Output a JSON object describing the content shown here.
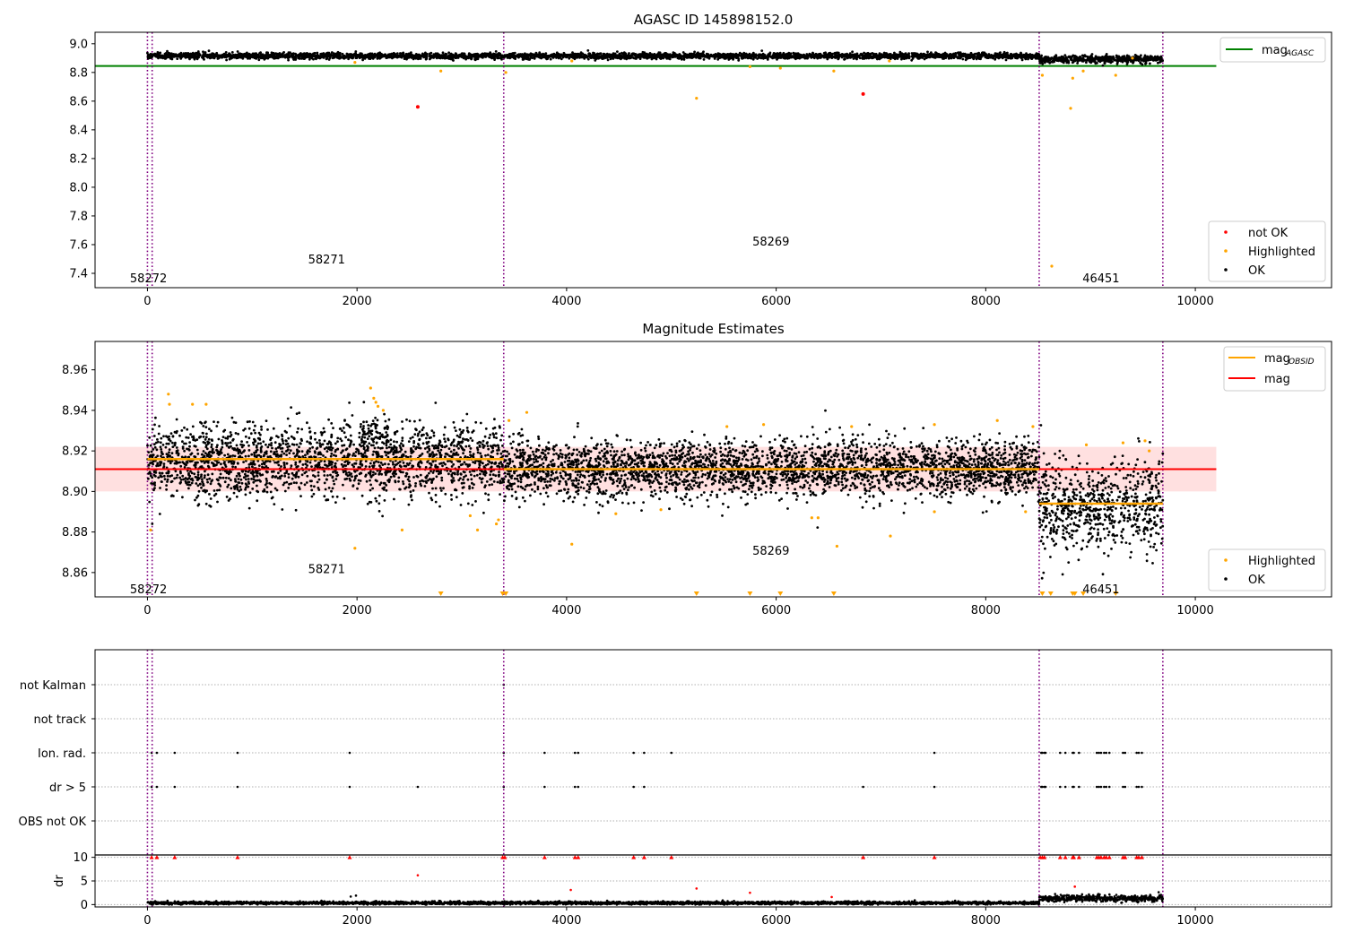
{
  "chart_data": [
    {
      "type": "scatter",
      "title": "AGASC ID 145898152.0",
      "xlim": [
        -500,
        11300
      ],
      "ylim": [
        7.3,
        9.08
      ],
      "xticks": [
        0,
        2000,
        4000,
        6000,
        8000,
        10000
      ],
      "yticks": [
        7.4,
        7.6,
        7.8,
        8.0,
        8.2,
        8.4,
        8.6,
        8.8,
        9.0
      ],
      "mag_agasc": 8.845,
      "obs_boundaries": [
        0,
        45,
        3400,
        8510,
        9690
      ],
      "obs_labels": [
        {
          "text": "58272",
          "x": 10,
          "y": 7.37
        },
        {
          "text": "58271",
          "x": 1710,
          "y": 7.5
        },
        {
          "text": "58269",
          "x": 5950,
          "y": 7.625
        },
        {
          "text": "46451",
          "x": 9100,
          "y": 7.37
        }
      ],
      "ok_segments": [
        {
          "x0": 0,
          "x1": 8510,
          "mean": 8.915,
          "sd": 0.01
        },
        {
          "x0": 8510,
          "x1": 9690,
          "mean": 8.893,
          "sd": 0.013
        }
      ],
      "not_ok": [
        [
          2580,
          8.56
        ],
        [
          6830,
          8.65
        ]
      ],
      "highlighted": [
        [
          2800,
          8.81
        ],
        [
          1980,
          8.87
        ],
        [
          3420,
          8.8
        ],
        [
          5240,
          8.62
        ],
        [
          5750,
          8.84
        ],
        [
          6040,
          8.83
        ],
        [
          6550,
          8.81
        ],
        [
          7080,
          8.88
        ],
        [
          4050,
          8.88
        ],
        [
          8540,
          8.78
        ],
        [
          8810,
          8.55
        ],
        [
          8830,
          8.76
        ],
        [
          8930,
          8.81
        ],
        [
          8630,
          7.45
        ],
        [
          9240,
          8.78
        ],
        [
          9400,
          8.9
        ]
      ],
      "legend_lines": [
        {
          "name": "mag",
          "sub": "AGASC",
          "color": "#008000"
        }
      ],
      "legend_points": [
        {
          "name": "not OK",
          "color": "#ff0000"
        },
        {
          "name": "Highlighted",
          "color": "#ffa500"
        },
        {
          "name": "OK",
          "color": "#000000"
        }
      ]
    },
    {
      "type": "scatter",
      "title": "Magnitude Estimates",
      "xlim": [
        -500,
        11300
      ],
      "ylim": [
        8.848,
        8.974
      ],
      "xticks": [
        0,
        2000,
        4000,
        6000,
        8000,
        10000
      ],
      "yticks": [
        8.86,
        8.88,
        8.9,
        8.92,
        8.94,
        8.96
      ],
      "mag": 8.911,
      "mag_band": [
        8.9,
        8.922
      ],
      "mag_obsid_segments": [
        {
          "x0": 0,
          "x1": 3400,
          "y": 8.916
        },
        {
          "x0": 3400,
          "x1": 8510,
          "y": 8.911
        },
        {
          "x0": 8510,
          "x1": 9690,
          "y": 8.894
        }
      ],
      "obs_boundaries": [
        0,
        45,
        3400,
        8510,
        9690
      ],
      "obs_labels": [
        {
          "text": "58272",
          "x": 10,
          "y": 8.852
        },
        {
          "text": "58271",
          "x": 1710,
          "y": 8.862
        },
        {
          "text": "58269",
          "x": 5950,
          "y": 8.871
        },
        {
          "text": "46451",
          "x": 9100,
          "y": 8.852
        }
      ],
      "ok_segments": [
        {
          "x0": 0,
          "x1": 3400,
          "mean": 8.915,
          "sd": 0.009
        },
        {
          "x0": 3400,
          "x1": 8510,
          "mean": 8.911,
          "sd": 0.007
        },
        {
          "x0": 8510,
          "x1": 9690,
          "mean": 8.893,
          "sd": 0.011
        }
      ],
      "highlighted": [
        [
          200,
          8.948
        ],
        [
          210,
          8.943
        ],
        [
          430,
          8.943
        ],
        [
          560,
          8.943
        ],
        [
          2130,
          8.951
        ],
        [
          2160,
          8.946
        ],
        [
          2180,
          8.944
        ],
        [
          2200,
          8.942
        ],
        [
          2250,
          8.94
        ],
        [
          30,
          8.881
        ],
        [
          1980,
          8.872
        ],
        [
          2430,
          8.881
        ],
        [
          3080,
          8.888
        ],
        [
          3150,
          8.881
        ],
        [
          3330,
          8.884
        ],
        [
          3350,
          8.886
        ],
        [
          3450,
          8.935
        ],
        [
          3620,
          8.939
        ],
        [
          4050,
          8.874
        ],
        [
          4470,
          8.889
        ],
        [
          4900,
          8.891
        ],
        [
          5530,
          8.932
        ],
        [
          5880,
          8.933
        ],
        [
          6340,
          8.887
        ],
        [
          6400,
          8.887
        ],
        [
          6580,
          8.873
        ],
        [
          6720,
          8.932
        ],
        [
          7090,
          8.878
        ],
        [
          7510,
          8.89
        ],
        [
          7510,
          8.933
        ],
        [
          8110,
          8.935
        ],
        [
          8380,
          8.89
        ],
        [
          8450,
          8.932
        ],
        [
          8960,
          8.923
        ],
        [
          9310,
          8.924
        ],
        [
          9520,
          8.925
        ],
        [
          9560,
          8.92
        ]
      ],
      "off_scale_markers": [
        2800,
        3390,
        3420,
        5240,
        5750,
        6040,
        6550,
        8540,
        8620,
        8830,
        8850,
        8930,
        9240
      ],
      "legend_lines": [
        {
          "name": "mag",
          "sub": "OBSID",
          "color": "#ffa500"
        },
        {
          "name": "mag",
          "sub": "",
          "color": "#ff0000"
        }
      ],
      "legend_points": [
        {
          "name": "Highlighted",
          "color": "#ffa500"
        },
        {
          "name": "OK",
          "color": "#000000"
        }
      ]
    },
    {
      "type": "scatter",
      "xlim": [
        -500,
        11300
      ],
      "xticks": [
        0,
        2000,
        4000,
        6000,
        8000,
        10000
      ],
      "flag_rows": [
        "not Kalman",
        "not track",
        "Ion. rad.",
        "dr > 5",
        "OBS not OK"
      ],
      "flags": {
        "not Kalman": [
          3400
        ],
        "not track": [],
        "Ion. rad.": [
          40,
          90,
          260,
          860,
          1930,
          3400,
          3790,
          4080,
          4110,
          4640,
          4740,
          5000,
          7510,
          8530,
          8540,
          8560,
          8570,
          8710,
          8760,
          8830,
          8840,
          8890,
          9060,
          9080,
          9100,
          9130,
          9150,
          9180,
          9310,
          9330,
          9440,
          9460,
          9490
        ],
        "dr > 5": [
          40,
          90,
          260,
          860,
          1930,
          2580,
          3400,
          3790,
          4080,
          4110,
          4640,
          4740,
          6830,
          7510,
          8530,
          8540,
          8560,
          8570,
          8710,
          8760,
          8830,
          8840,
          8890,
          9060,
          9080,
          9100,
          9130,
          9150,
          9180,
          9310,
          9330,
          9440,
          9460,
          9490
        ],
        "OBS not OK": []
      },
      "dr_ylabel": "dr",
      "dr_ylim": [
        -0.5,
        10.5
      ],
      "dr_yticks": [
        0,
        5,
        10
      ],
      "dr_capped": [
        40,
        90,
        260,
        860,
        1930,
        3390,
        3410,
        3790,
        4080,
        4110,
        4640,
        4740,
        5000,
        6830,
        7510,
        8520,
        8540,
        8560,
        8710,
        8760,
        8830,
        8840,
        8890,
        9060,
        9080,
        9100,
        9130,
        9150,
        9180,
        9310,
        9330,
        9440,
        9460,
        9490
      ],
      "dr_points": [
        [
          2580,
          6.2
        ],
        [
          4040,
          3.1
        ],
        [
          5240,
          3.4
        ],
        [
          5750,
          2.5
        ],
        [
          6530,
          1.6
        ],
        [
          8850,
          3.8
        ],
        [
          1940,
          1.7
        ],
        [
          1990,
          1.9
        ]
      ],
      "dr_segments": [
        {
          "x0": 0,
          "x1": 8510,
          "mean": 0.35,
          "sd": 0.15
        },
        {
          "x0": 8510,
          "x1": 9690,
          "mean": 1.3,
          "sd": 0.35
        }
      ]
    }
  ]
}
